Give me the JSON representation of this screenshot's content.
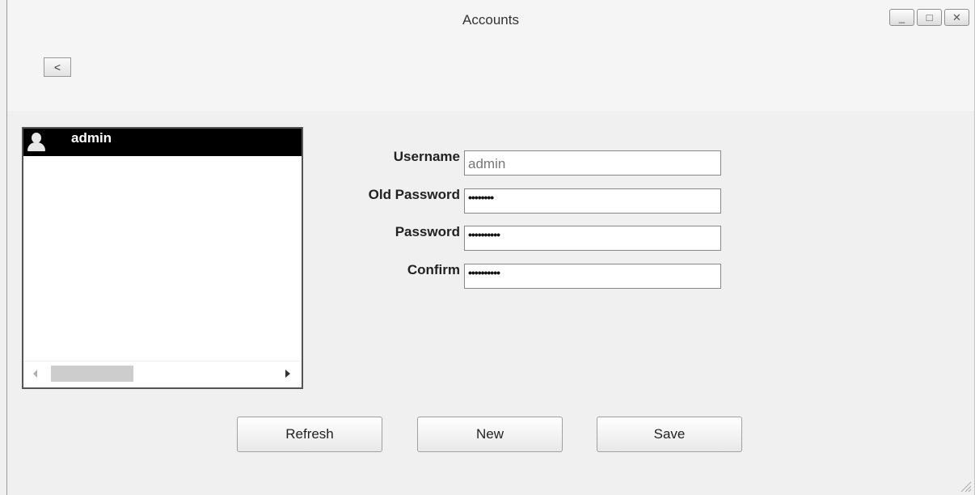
{
  "window": {
    "title": "Accounts",
    "controls": {
      "minimize": "_",
      "maximize": "□",
      "close": "✕"
    }
  },
  "nav": {
    "back_label": "<"
  },
  "accounts_list": {
    "items": [
      {
        "label": "admin",
        "icon": "user-icon"
      }
    ]
  },
  "form": {
    "username_label": "Username",
    "username_value": "admin",
    "old_password_label": "Old Password",
    "old_password_value": "••••••••",
    "password_label": "Password",
    "password_value": "••••••••••",
    "confirm_label": "Confirm",
    "confirm_value": "••••••••••"
  },
  "buttons": {
    "refresh": "Refresh",
    "new": "New",
    "save": "Save"
  },
  "colors": {
    "selection_background": "#000000",
    "selection_text": "#ffffff",
    "window_background": "#f0f0f0"
  }
}
